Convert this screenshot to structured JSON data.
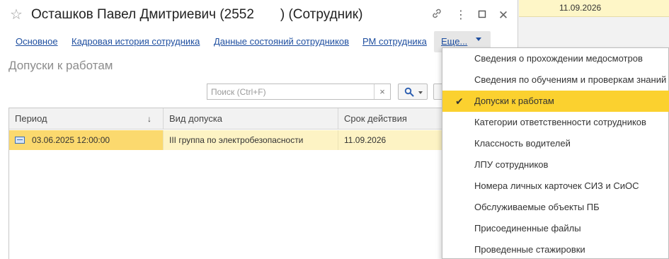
{
  "background_window": {
    "date": "11.09.2026"
  },
  "window": {
    "title": "Осташков Павел Дмитриевич (2552       ) (Сотрудник)",
    "icons": [
      "star-icon",
      "link-icon",
      "more-vertical-icon",
      "maximize-icon",
      "close-icon"
    ]
  },
  "tabs": [
    {
      "label": "Основное"
    },
    {
      "label": "Кадровая история сотрудника"
    },
    {
      "label": "Данные состояний сотрудников"
    },
    {
      "label": "РМ сотрудника"
    }
  ],
  "tab_more": {
    "label": "Еще..."
  },
  "section_title": "Допуски к работам",
  "search": {
    "placeholder": "Поиск (Ctrl+F)",
    "value": "",
    "clear": "×"
  },
  "table": {
    "columns": [
      {
        "label": "Период"
      },
      {
        "label": "Вид допуска"
      },
      {
        "label": "Срок действия"
      }
    ],
    "sort_indicator": "↓",
    "rows": [
      {
        "period": "03.06.2025 12:00:00",
        "type": "III группа по электробезопасности",
        "expiry": "11.09.2026"
      }
    ]
  },
  "menu": {
    "items": [
      {
        "label": "Сведения о прохождении медосмотров"
      },
      {
        "label": "Сведения по обучениям и проверкам знаний"
      },
      {
        "label": "Допуски к работам"
      },
      {
        "label": "Категории ответственности сотрудников"
      },
      {
        "label": "Классность водителей"
      },
      {
        "label": "ЛПУ сотрудников"
      },
      {
        "label": "Номера личных карточек СИЗ и СиОС"
      },
      {
        "label": "Обслуживаемые объекты ПБ"
      },
      {
        "label": "Присоединенные файлы"
      },
      {
        "label": "Проведенные стажировки"
      }
    ],
    "active_index": 2,
    "check": "✔"
  },
  "colors": {
    "accent_yellow": "#fbd12f",
    "row_highlight": "#fdf3c4",
    "link_blue": "#1f4fa0"
  }
}
